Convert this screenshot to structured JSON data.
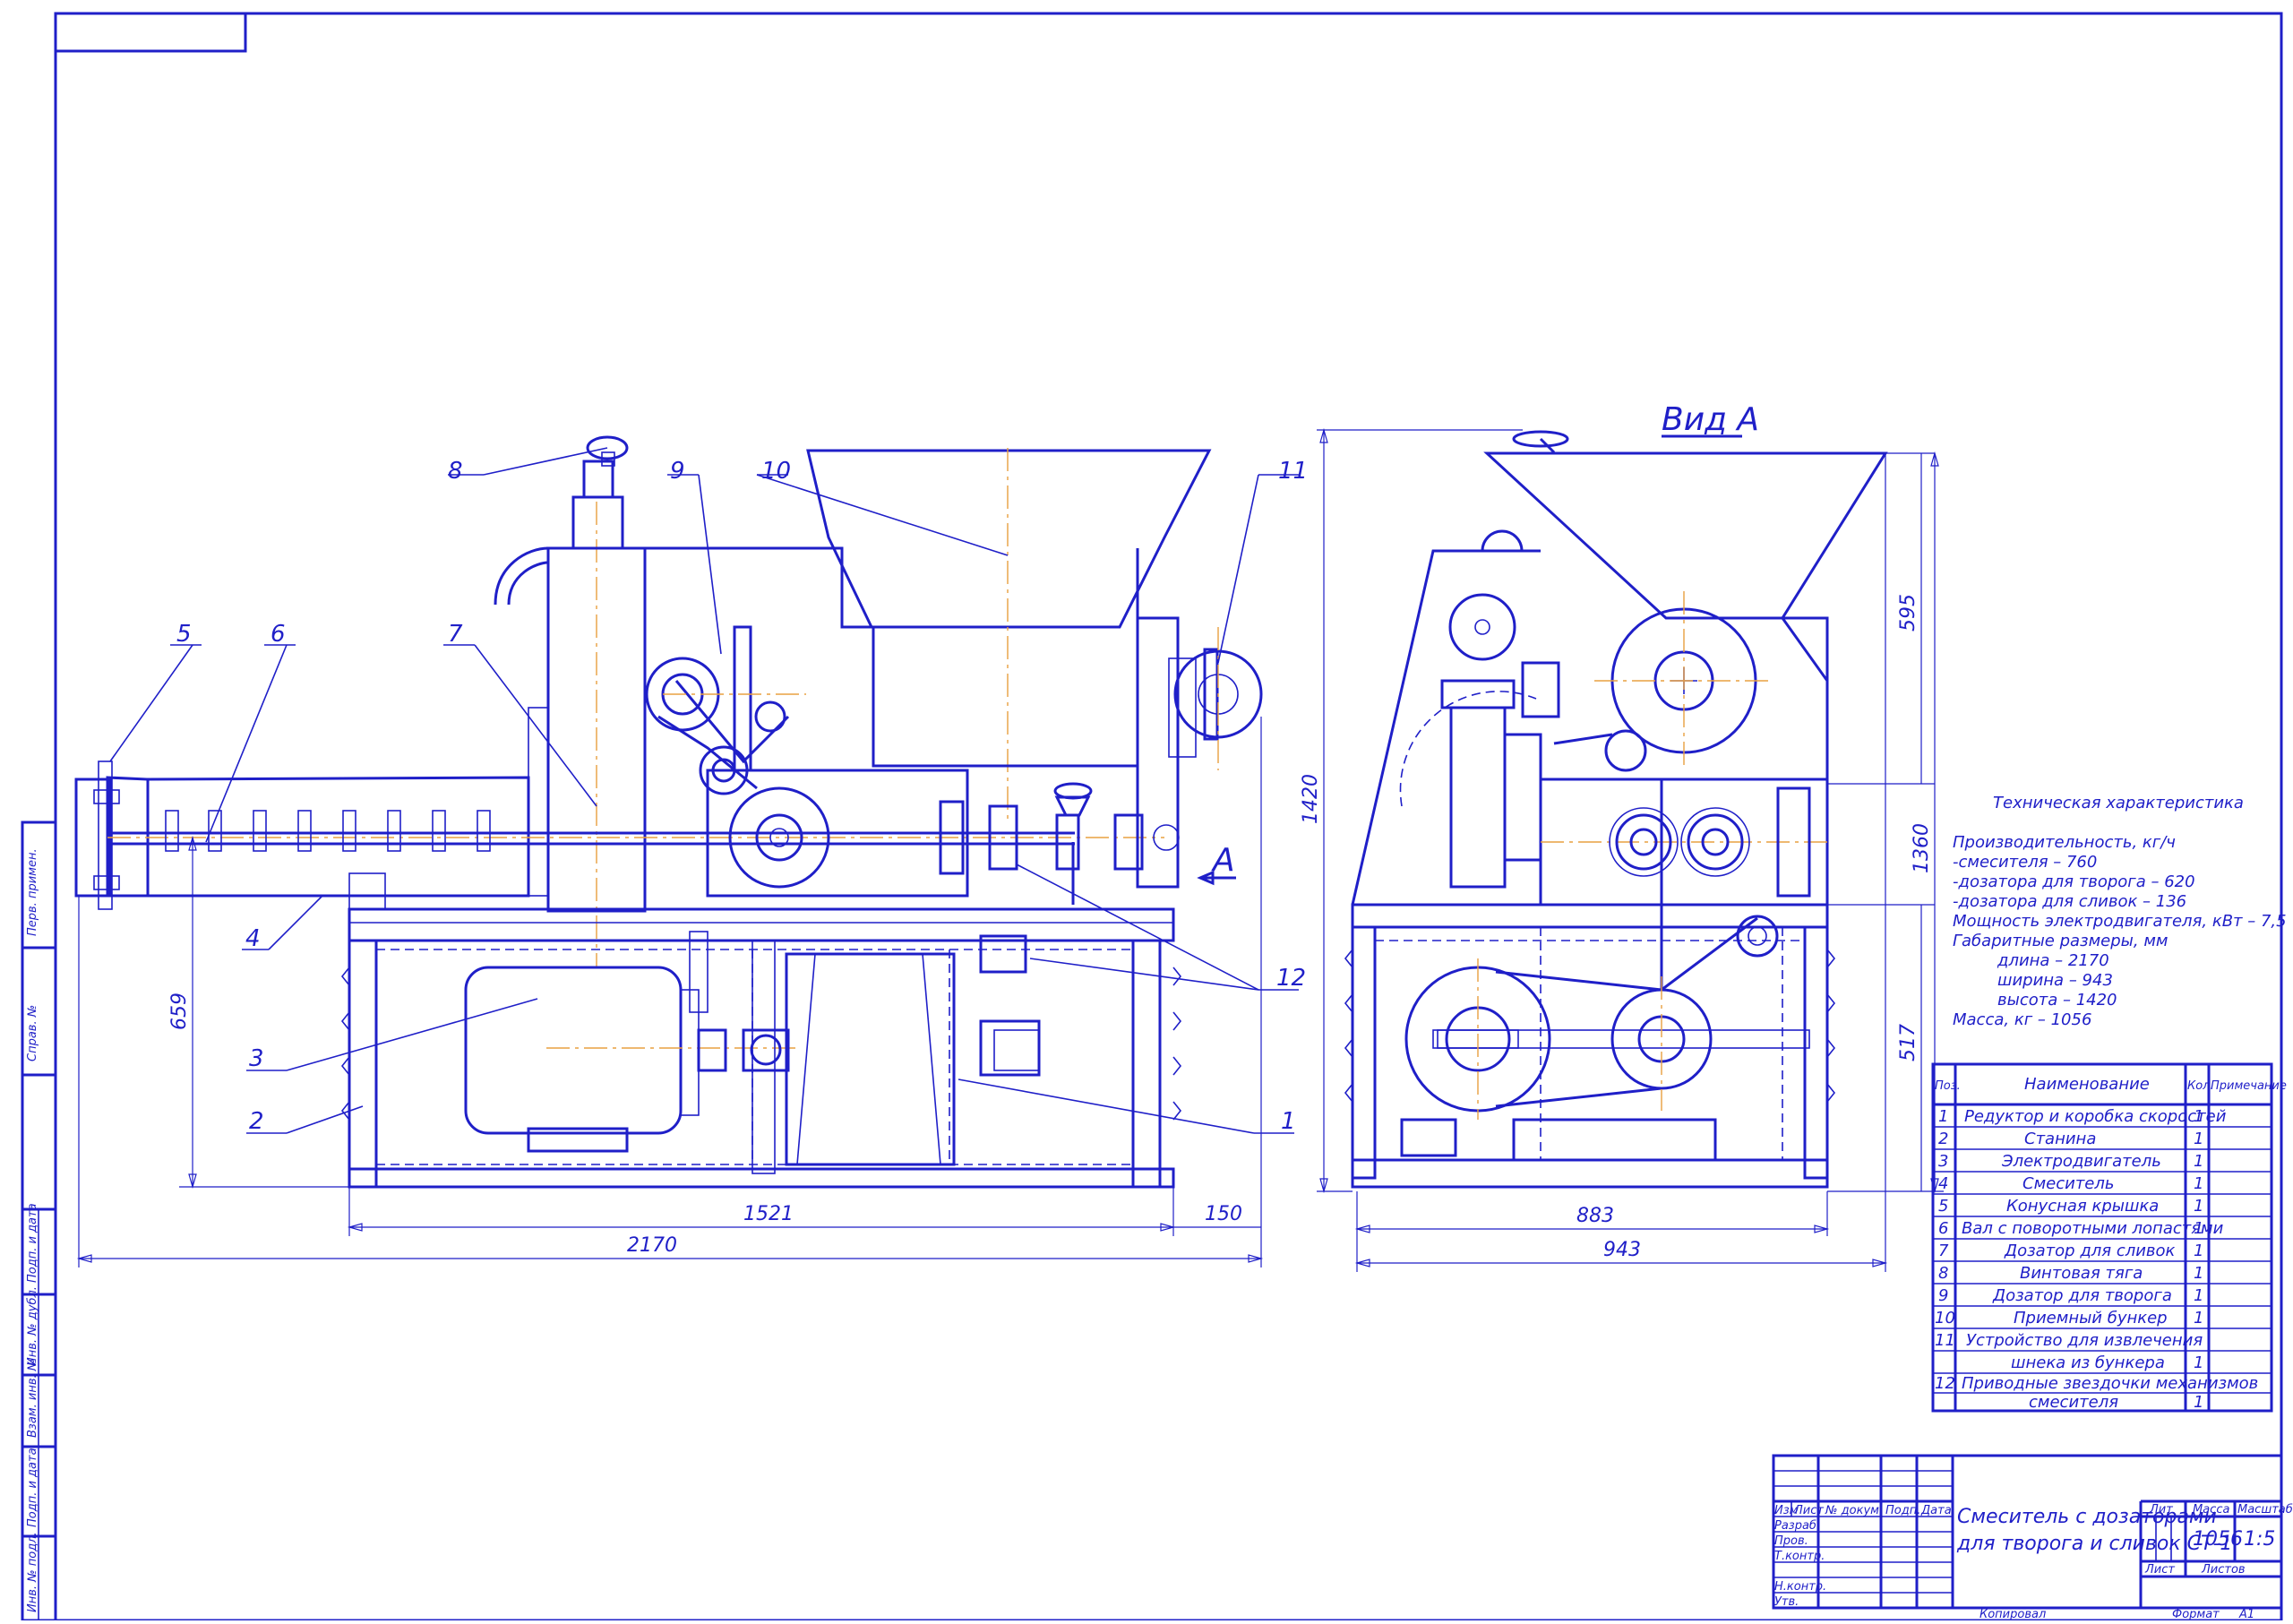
{
  "colors": {
    "line": "#1f1fc8",
    "axis": "#e8a040",
    "background": "#ffffff"
  },
  "dimensions": {
    "length_total": "2170",
    "frame_length": "1521",
    "overhang": "150",
    "height_lower": "659",
    "height_total": "1420",
    "view_width": "883",
    "view_width_total": "943",
    "vdim_595": "595",
    "vdim_1360": "1360",
    "vdim_517": "517"
  },
  "view_a_title": "Вид А",
  "section_arrow_label": "А",
  "callouts": [
    "1",
    "2",
    "3",
    "4",
    "5",
    "6",
    "7",
    "8",
    "9",
    "10",
    "11",
    "12"
  ],
  "tech": {
    "title": "Техническая характеристика",
    "lines": [
      "Производительность, кг/ч",
      " -смесителя – 760",
      " -дозатора для творога – 620",
      " -дозатора для сливок – 136",
      "Мощность электродвигателя, кВт – 7,5",
      "Габаритные размеры, мм",
      "длина – 2170",
      "ширина – 943",
      "высота – 1420",
      "Масса, кг – 1056"
    ]
  },
  "spec": {
    "headers": [
      "Поз.",
      "Наименование",
      "Кол.",
      "Примечание"
    ],
    "rows": [
      {
        "pos": "1",
        "name": "Редуктор и коробка скоростей",
        "qty": "1"
      },
      {
        "pos": "2",
        "name": "Станина",
        "qty": "1"
      },
      {
        "pos": "3",
        "name": "Электродвигатель",
        "qty": "1"
      },
      {
        "pos": "4",
        "name": "Смеситель",
        "qty": "1"
      },
      {
        "pos": "5",
        "name": "Конусная крышка",
        "qty": "1"
      },
      {
        "pos": "6",
        "name": "Вал с поворотными лопастями",
        "qty": "1"
      },
      {
        "pos": "7",
        "name": "Дозатор для сливок",
        "qty": "1"
      },
      {
        "pos": "8",
        "name": "Винтовая тяга",
        "qty": "1"
      },
      {
        "pos": "9",
        "name": "Дозатор для творога",
        "qty": "1"
      },
      {
        "pos": "10",
        "name": "Приемный бункер",
        "qty": "1"
      },
      {
        "pos": "11",
        "name": "Устройство для извлечения",
        "qty": ""
      },
      {
        "pos": "",
        "name": "шнека из бункера",
        "qty": "1"
      },
      {
        "pos": "12",
        "name": "Приводные звездочки механизмов",
        "qty": ""
      },
      {
        "pos": "",
        "name": "смесителя",
        "qty": "1"
      }
    ]
  },
  "title_block": {
    "title_line1": "Смеситель с дозаторами",
    "title_line2": "для творога и сливок СТ-1",
    "col_lit": "Лит",
    "col_mass": "Масса",
    "col_scale": "Масштаб",
    "mass": "1056",
    "scale": "1:5",
    "sheet": "Лист",
    "sheets": "Листов",
    "rev_headers": [
      "Изм",
      "Лист",
      "№ докум.",
      "Подп.",
      "Дата"
    ],
    "roles": [
      "Разраб.",
      "Пров.",
      "Т.контр.",
      "",
      "Н.контр.",
      "Утв."
    ],
    "copied": "Копировал",
    "format_label": "Формат",
    "format": "A1"
  },
  "side_stamps": [
    "Перв. примен.",
    "Справ. №",
    "Подп. и дата",
    "Инв. № дубл.",
    "Взам. инв. №",
    "Подп. и дата",
    "Инв. № подл."
  ]
}
